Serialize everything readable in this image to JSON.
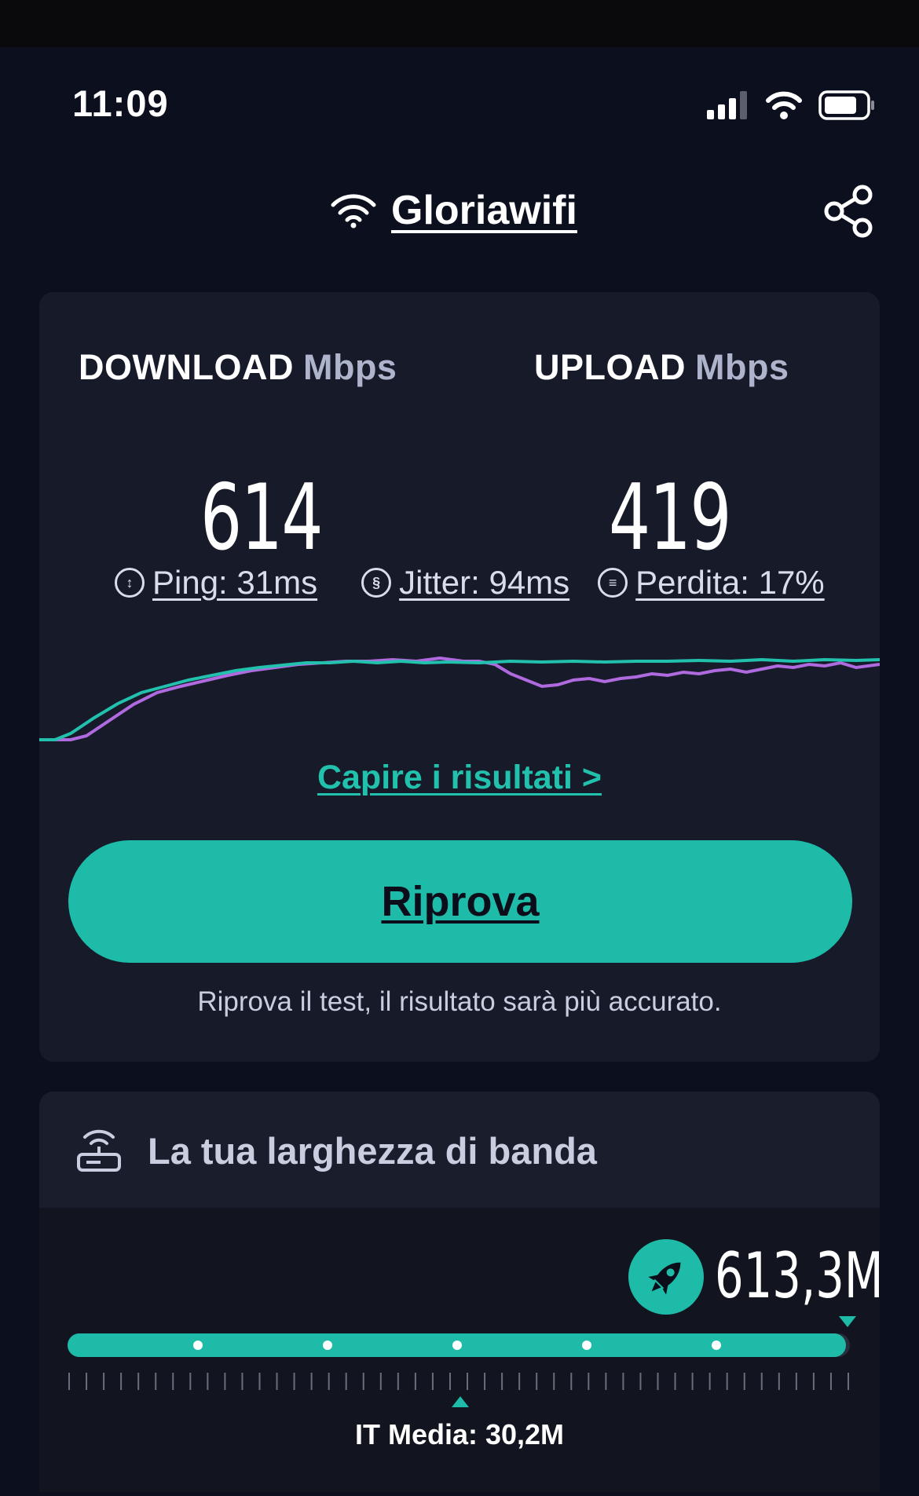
{
  "status_bar": {
    "time": "11:09"
  },
  "header": {
    "network_name": "Gloriawifi"
  },
  "results": {
    "download": {
      "label": "DOWNLOAD",
      "unit": "Mbps",
      "value": "614"
    },
    "upload": {
      "label": "UPLOAD",
      "unit": "Mbps",
      "value": "419"
    },
    "ping": "Ping: 31ms",
    "jitter": "Jitter: 94ms",
    "loss": "Perdita: 17%",
    "understand_link": "Capire i risultati >",
    "retry_label": "Riprova",
    "retry_hint": "Riprova il test, il risultato sarà più accurato."
  },
  "bandwidth": {
    "title": "La tua larghezza di banda",
    "value": "613,3M",
    "average_label": "IT Media: 30,2M",
    "fill_fraction": 0.995
  },
  "colors": {
    "accent": "#1ebca8",
    "download_line": "#21c1ad",
    "upload_line": "#b06ae0",
    "background": "#0c0f1d",
    "card": "#171b29"
  },
  "icons": {
    "status": [
      "cellular-signal-icon",
      "wifi-icon",
      "battery-icon"
    ],
    "header": [
      "wifi-icon",
      "share-icon"
    ],
    "stats": [
      "ping-icon",
      "jitter-icon",
      "packet-loss-icon"
    ],
    "bandwidth": [
      "router-icon",
      "rocket-icon"
    ]
  }
}
